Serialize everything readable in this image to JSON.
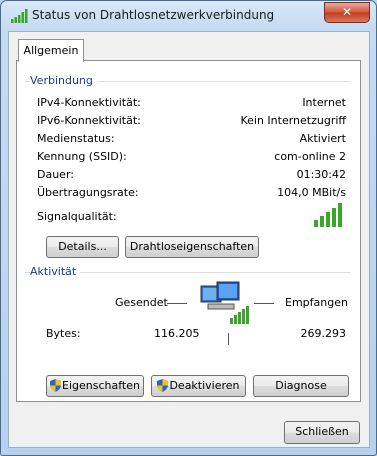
{
  "window": {
    "title": "Status von Drahtlosnetzwerkverbindung",
    "close_label": "✕"
  },
  "tabs": [
    {
      "label": "Allgemein"
    }
  ],
  "connection": {
    "group_label": "Verbindung",
    "rows": [
      {
        "label": "IPv4-Konnektivität:",
        "value": "Internet"
      },
      {
        "label": "IPv6-Konnektivität:",
        "value": "Kein Internetzugriff"
      },
      {
        "label": "Medienstatus:",
        "value": "Aktiviert"
      },
      {
        "label": "Kennung (SSID):",
        "value": "com-online 2"
      },
      {
        "label": "Dauer:",
        "value": "01:30:42"
      },
      {
        "label": "Übertragungsrate:",
        "value": "104,0 MBit/s"
      }
    ],
    "signal_label": "Signalqualität:",
    "signal_bars": 5,
    "details_button": "Details...",
    "wireless_props_button": "Drahtloseigenschaften"
  },
  "activity": {
    "group_label": "Aktivität",
    "sent_label": "Gesendet",
    "received_label": "Empfangen",
    "bytes_label": "Bytes:",
    "bytes_sent": "116.205",
    "bytes_received": "269.293"
  },
  "actions": {
    "properties_button": "Eigenschaften",
    "deactivate_button": "Deaktivieren",
    "diagnose_button": "Diagnose"
  },
  "footer": {
    "close_button": "Schließen"
  },
  "colors": {
    "signal_green": "#3aa52a",
    "link_blue": "#1a3a8a"
  }
}
